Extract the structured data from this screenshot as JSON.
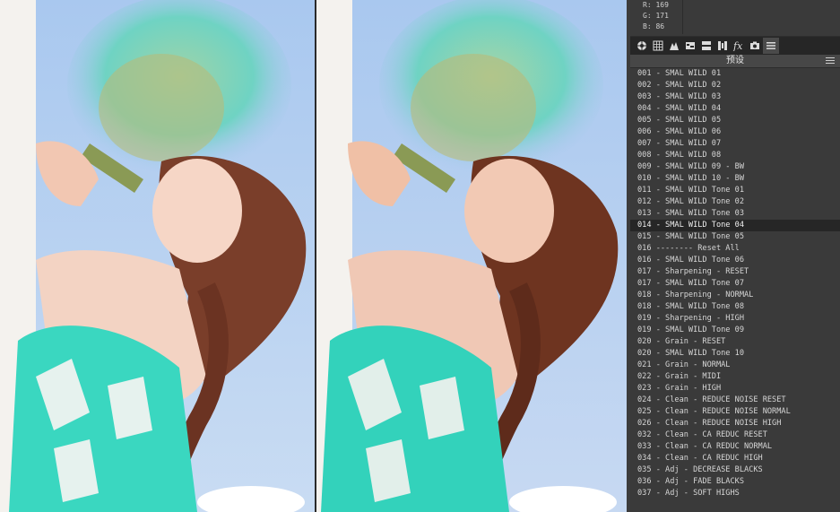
{
  "info": {
    "r": "R:  169",
    "g": "G:  171",
    "b": "B:   86"
  },
  "tabs": [
    {
      "icon": "aperture-icon"
    },
    {
      "icon": "basic-grid-icon"
    },
    {
      "icon": "tone-curve-icon"
    },
    {
      "icon": "hsl-icon"
    },
    {
      "icon": "split-toning-icon"
    },
    {
      "icon": "detail-icon"
    },
    {
      "icon": "fx-icon"
    },
    {
      "icon": "camera-icon"
    },
    {
      "icon": "presets-icon"
    }
  ],
  "presets": {
    "title": "预设",
    "selected_index": 13,
    "items": [
      "001 - SMAL WILD 01",
      "002 - SMAL WILD 02",
      "003 - SMAL WILD 03",
      "004 - SMAL WILD 04",
      "005 - SMAL WILD 05",
      "006 - SMAL WILD 06",
      "007 - SMAL WILD 07",
      "008 - SMAL WILD 08",
      "009 - SMAL WILD 09 - BW",
      "010 - SMAL WILD 10 - BW",
      "011 - SMAL WILD Tone 01",
      "012 - SMAL WILD Tone 02",
      "013 - SMAL WILD Tone 03",
      "014 - SMAL WILD Tone 04",
      "015 - SMAL WILD Tone 05",
      "016 -------- Reset All",
      "016 - SMAL WILD Tone 06",
      "017 - Sharpening - RESET",
      "017 - SMAL WILD Tone 07",
      "018 - Sharpening - NORMAL",
      "018 - SMAL WILD Tone 08",
      "019 - Sharpening - HIGH",
      "019 - SMAL WILD Tone 09",
      "020 - Grain - RESET",
      "020 - SMAL WILD Tone 10",
      "021 - Grain - NORMAL",
      "022 - Grain - MIDI",
      "023 - Grain - HIGH",
      "024 - Clean - REDUCE NOISE RESET",
      "025 - Clean - REDUCE NOISE NORMAL",
      "026 - Clean - REDUCE NOISE HIGH",
      "032 - Clean - CA REDUC RESET",
      "033 - Clean - CA REDUC NORMAL",
      "034 - Clean - CA REDUC HIGH",
      "035 - Adj - DECREASE BLACKS",
      "036 - Adj - FADE BLACKS",
      "037 - Adj - SOFT HIGHS"
    ]
  },
  "colors": {
    "panel_bg": "#3a3a3a",
    "tab_bar": "#262626",
    "selected_row": "#262626",
    "text": "#d6d6d6"
  }
}
